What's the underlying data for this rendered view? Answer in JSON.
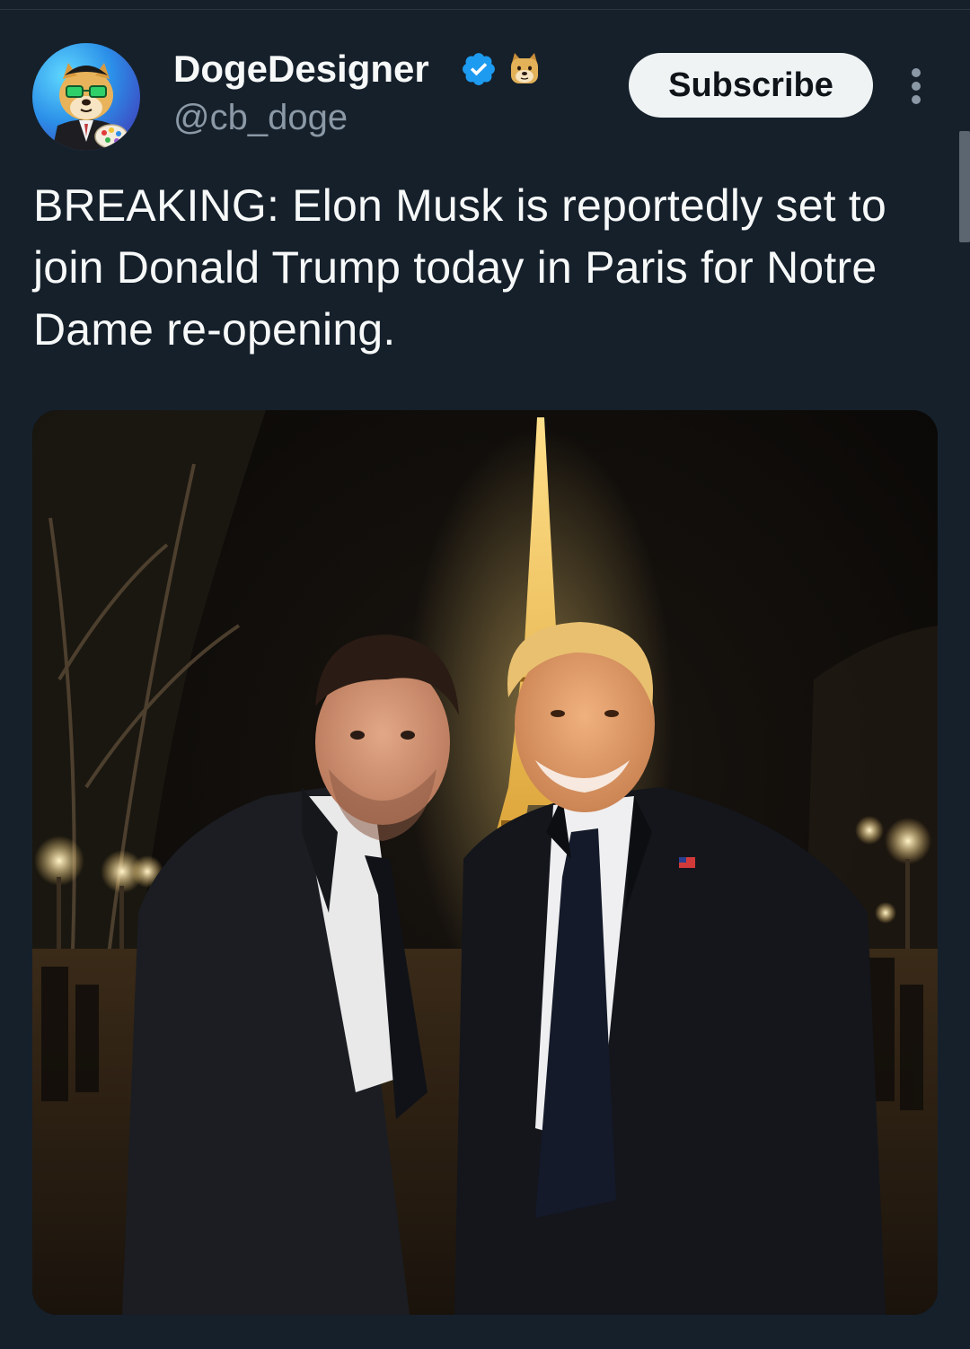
{
  "author": {
    "name": "DogeDesigner",
    "handle": "@cb_doge",
    "avatar_icon": "doge-painter-avatar",
    "verified_icon": "verified-badge-icon",
    "verified_color": "#1d9bf0",
    "emoji_icon": "doge-emoji"
  },
  "actions": {
    "subscribe_label": "Subscribe",
    "more_icon": "more-options-icon"
  },
  "tweet": {
    "text": "BREAKING: Elon Musk is reportedly set to join Donald Trump today in Paris for Notre Dame re-opening."
  },
  "media": {
    "type": "photo"
  },
  "colors": {
    "background": "#15202b",
    "text_primary": "#f7f9f9",
    "text_secondary": "#8b98a5",
    "button_bg": "#eff3f4",
    "button_text": "#0f1419"
  }
}
